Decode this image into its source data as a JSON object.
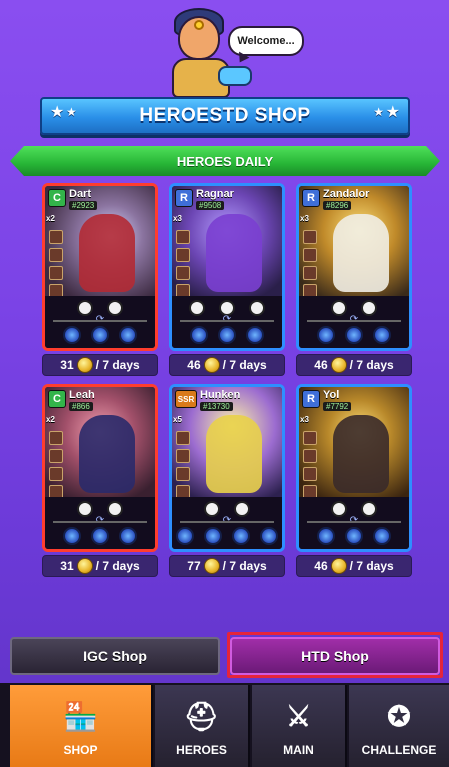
{
  "header": {
    "speech_bubble": "Welcome...",
    "title": "HEROESTD SHOP",
    "section_ribbon": "HEROES DAILY"
  },
  "heroes": [
    {
      "name": "Dart",
      "rank": "C",
      "id": "#2923",
      "copies": "x2",
      "price": "31",
      "period": "/ 7 days"
    },
    {
      "name": "Ragnar",
      "rank": "R",
      "id": "#9508",
      "copies": "x3",
      "price": "46",
      "period": "/ 7 days"
    },
    {
      "name": "Zandalor",
      "rank": "R",
      "id": "#8296",
      "copies": "x3",
      "price": "46",
      "period": "/ 7 days"
    },
    {
      "name": "Leah",
      "rank": "C",
      "id": "#866",
      "copies": "x2",
      "price": "31",
      "period": "/ 7 days"
    },
    {
      "name": "Hunken",
      "rank": "SSR",
      "id": "#13730",
      "copies": "x5",
      "price": "77",
      "period": "/ 7 days"
    },
    {
      "name": "Yol",
      "rank": "R",
      "id": "#7792",
      "copies": "x3",
      "price": "46",
      "period": "/ 7 days"
    }
  ],
  "shop_tabs": {
    "igc_label": "IGC Shop",
    "htd_label": "HTD Shop",
    "selected": "HTD Shop"
  },
  "nav": {
    "shop": "SHOP",
    "heroes": "HEROES",
    "main": "MAIN",
    "challenge": "CHALLENGE",
    "active": "SHOP"
  },
  "colors": {
    "background": "#7b43e6",
    "banner_blue": "#2a8fe8",
    "ribbon_green": "#27b536",
    "active_tab": "#e87a16",
    "highlight_red": "#e5243b"
  }
}
